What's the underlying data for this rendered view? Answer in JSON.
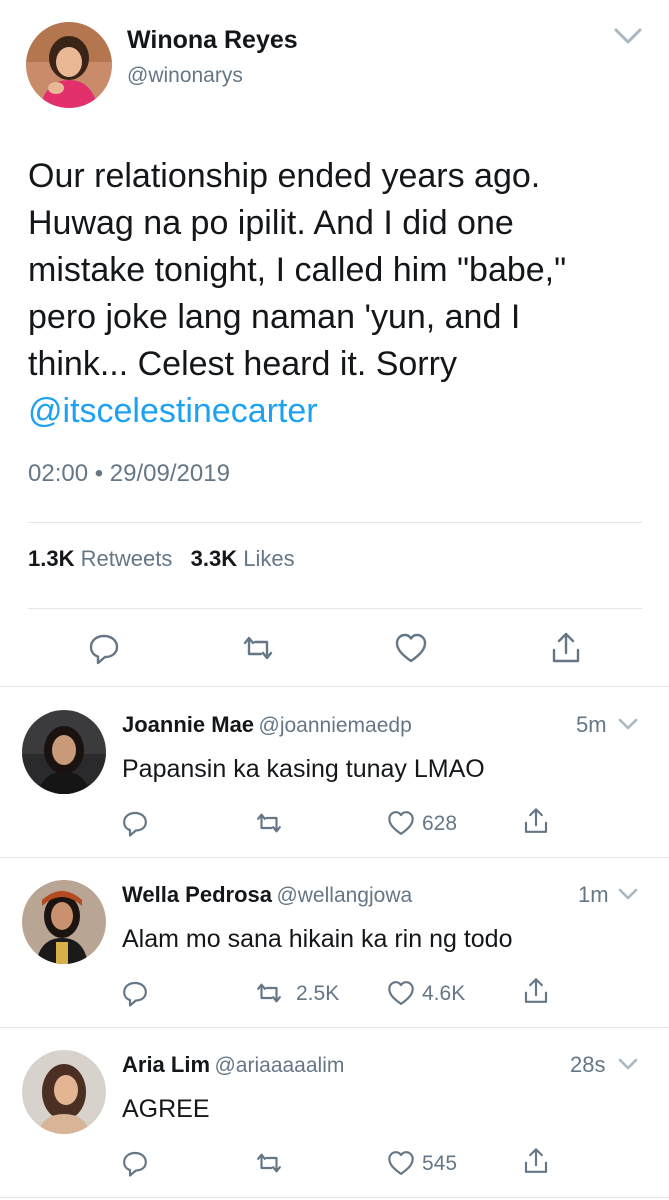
{
  "main_tweet": {
    "author_name": "Winona Reyes",
    "author_handle": "@winonarys",
    "text_line1": "Our relationship ended years ago.",
    "text_line2": "Huwag na po ipilit. And I did one",
    "text_line3": "mistake tonight, I called him \"babe,\"",
    "text_line4": "pero joke lang naman 'yun, and I",
    "text_line5": "think... Celest heard it. Sorry",
    "mention": "@itscelestinecarter",
    "timestamp": "02:00 • 29/09/2019",
    "retweet_count": "1.3K",
    "retweet_label": "Retweets",
    "like_count": "3.3K",
    "like_label": "Likes"
  },
  "replies": [
    {
      "name": "Joannie Mae",
      "handle": "@joanniemaedp",
      "time": "5m",
      "text": "Papansin ka kasing tunay LMAO",
      "retweets": "",
      "likes": "628"
    },
    {
      "name": "Wella Pedrosa",
      "handle": "@wellangjowa",
      "time": "1m",
      "text": "Alam mo sana hikain ka rin ng todo",
      "retweets": "2.5K",
      "likes": "4.6K"
    },
    {
      "name": "Aria Lim",
      "handle": "@ariaaaaalim",
      "time": "28s",
      "text": "AGREE",
      "retweets": "",
      "likes": "545"
    }
  ],
  "colors": {
    "link": "#1da1f2",
    "secondary_text": "#657786",
    "divider": "#e1e8ed"
  }
}
